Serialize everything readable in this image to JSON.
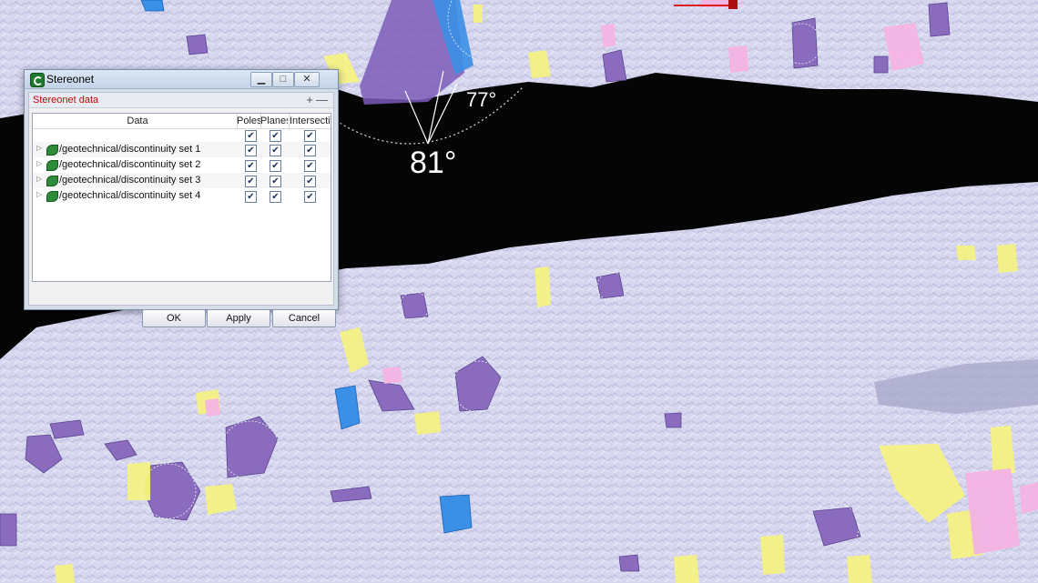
{
  "window": {
    "title": "Stereonet",
    "minimize": "▁",
    "maximize": "□",
    "close": "✕"
  },
  "panel": {
    "title": "Stereonet data",
    "plus": "+",
    "minus": "—"
  },
  "table": {
    "columns": [
      "Data",
      "Poles",
      "Planes",
      "Intersections"
    ],
    "header_checks": {
      "poles": true,
      "planes": true,
      "intersections": true
    },
    "rows": [
      {
        "label": "/geotechnical/discontinuity set 1",
        "poles": true,
        "planes": true,
        "intersections": true
      },
      {
        "label": "/geotechnical/discontinuity set 2",
        "poles": true,
        "planes": true,
        "intersections": true
      },
      {
        "label": "/geotechnical/discontinuity set 3",
        "poles": true,
        "planes": true,
        "intersections": true
      },
      {
        "label": "/geotechnical/discontinuity set 4",
        "poles": true,
        "planes": true,
        "intersections": true
      }
    ]
  },
  "buttons": {
    "ok": "OK",
    "apply": "Apply",
    "cancel": "Cancel"
  },
  "viewport": {
    "angle_labels": [
      "77°",
      "81°"
    ],
    "colors": {
      "rock_surface": "#d4d4ee",
      "discontinuity_purple": "#8a6bbd",
      "discontinuity_yellow": "#f4f08a",
      "discontinuity_blue": "#3a8fe6",
      "discontinuity_pink": "#f2b3e6",
      "void": "#000000"
    }
  }
}
